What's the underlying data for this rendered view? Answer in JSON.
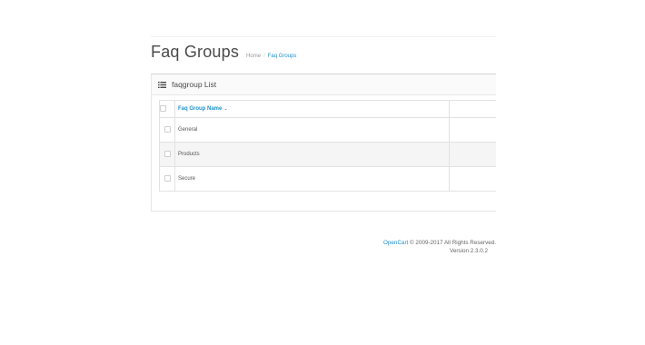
{
  "header": {
    "title": "Faq Groups",
    "breadcrumb": [
      {
        "label": "Home"
      },
      {
        "label": "Faq Groups"
      }
    ],
    "breadcrumb_separator": "/"
  },
  "panel": {
    "title": "faqgroup List",
    "icon": "list-icon"
  },
  "table": {
    "columns": [
      {
        "label": "Faq Group Name",
        "sort_indicator": "⌄"
      }
    ],
    "rows": [
      {
        "name": "General"
      },
      {
        "name": "Products"
      },
      {
        "name": "Secure"
      }
    ]
  },
  "footer": {
    "link_text": "OpenCart",
    "copyright": " © 2009-2017 All Rights Reserved.",
    "version": "Version 2.3.0.2"
  },
  "colors": {
    "accent": "#1e91cf",
    "row_stripe": "#f5f5f5"
  }
}
